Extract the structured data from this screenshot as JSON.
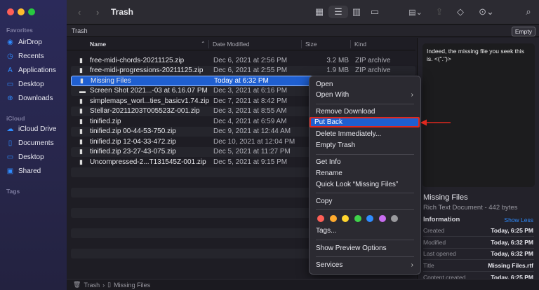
{
  "window": {
    "title": "Trash"
  },
  "sidebar": {
    "sections": [
      {
        "label": "Favorites",
        "items": [
          {
            "label": "AirDrop",
            "icon": "airdrop-icon"
          },
          {
            "label": "Recents",
            "icon": "clock-icon"
          },
          {
            "label": "Applications",
            "icon": "applications-icon"
          },
          {
            "label": "Desktop",
            "icon": "desktop-icon"
          },
          {
            "label": "Downloads",
            "icon": "download-icon"
          }
        ]
      },
      {
        "label": "iCloud",
        "items": [
          {
            "label": "iCloud Drive",
            "icon": "cloud-icon"
          },
          {
            "label": "Documents",
            "icon": "document-icon"
          },
          {
            "label": "Desktop",
            "icon": "desktop-icon"
          },
          {
            "label": "Shared",
            "icon": "shared-folder-icon"
          }
        ]
      },
      {
        "label": "Tags",
        "items": []
      }
    ]
  },
  "pathbar": {
    "title": "Trash",
    "empty_label": "Empty"
  },
  "columns": {
    "name": "Name",
    "date": "Date Modified",
    "size": "Size",
    "kind": "Kind"
  },
  "files": [
    {
      "name": "free-midi-chords-20211125.zip",
      "date": "Dec 6, 2021 at 2:56 PM",
      "size": "3.2 MB",
      "kind": "ZIP archive"
    },
    {
      "name": "free-midi-progressions-20211125.zip",
      "date": "Dec 6, 2021 at 2:55 PM",
      "size": "1.9 MB",
      "kind": "ZIP archive"
    },
    {
      "name": "Missing Files",
      "date": "Today at 6:32 PM",
      "size": "",
      "kind": ""
    },
    {
      "name": "Screen Shot 2021...-03 at 6.16.07 PM",
      "date": "Dec 3, 2021 at 6:16 PM",
      "size": "",
      "kind": ""
    },
    {
      "name": "simplemaps_worl...ties_basicv1.74.zip",
      "date": "Dec 7, 2021 at 8:42 PM",
      "size": "",
      "kind": ""
    },
    {
      "name": "Stellar-20211203T005523Z-001.zip",
      "date": "Dec 3, 2021 at 8:55 AM",
      "size": "",
      "kind": ""
    },
    {
      "name": "tinified.zip",
      "date": "Dec 4, 2021 at 6:59 AM",
      "size": "",
      "kind": ""
    },
    {
      "name": "tinified.zip 00-44-53-750.zip",
      "date": "Dec 9, 2021 at 12:44 AM",
      "size": "",
      "kind": ""
    },
    {
      "name": "tinified.zip 12-04-33-472.zip",
      "date": "Dec 10, 2021 at 12:04 PM",
      "size": "",
      "kind": ""
    },
    {
      "name": "tinified.zip 23-27-43-075.zip",
      "date": "Dec 5, 2021 at 11:27 PM",
      "size": "",
      "kind": ""
    },
    {
      "name": "Uncompressed-2...T131545Z-001.zip",
      "date": "Dec 5, 2021 at 9:15 PM",
      "size": "",
      "kind": ""
    }
  ],
  "selected_file": "Missing Files",
  "context_menu": {
    "open": "Open",
    "open_with": "Open With",
    "remove_download": "Remove Download",
    "put_back": "Put Back",
    "delete_immediately": "Delete Immediately...",
    "empty_trash": "Empty Trash",
    "get_info": "Get Info",
    "rename": "Rename",
    "quick_look": "Quick Look “Missing Files”",
    "copy": "Copy",
    "tags": "Tags...",
    "show_preview_options": "Show Preview Options",
    "services": "Services",
    "tag_colors": [
      "#ff5f57",
      "#ffaa2e",
      "#ffd52e",
      "#3fd24a",
      "#2f8cff",
      "#c86cf0",
      "#9a9a9e"
    ],
    "highlight_color": "#1f5fd0",
    "annotation_color": "#e0281e"
  },
  "preview": {
    "content": "Indeed, the missing file you seek this is. <(\".\")>",
    "title": "Missing Files",
    "subtitle": "Rich Text Document - 442 bytes",
    "info_label": "Information",
    "show_less": "Show Less",
    "rows": [
      {
        "label": "Created",
        "value": "Today, 6:25 PM"
      },
      {
        "label": "Modified",
        "value": "Today, 6:32 PM"
      },
      {
        "label": "Last opened",
        "value": "Today, 6:32 PM"
      },
      {
        "label": "Title",
        "value": "Missing Files.rtf"
      },
      {
        "label": "Content created",
        "value": "Today, 6:25 PM"
      }
    ]
  },
  "status": {
    "crumb1": "Trash",
    "crumb2": "Missing Files"
  }
}
